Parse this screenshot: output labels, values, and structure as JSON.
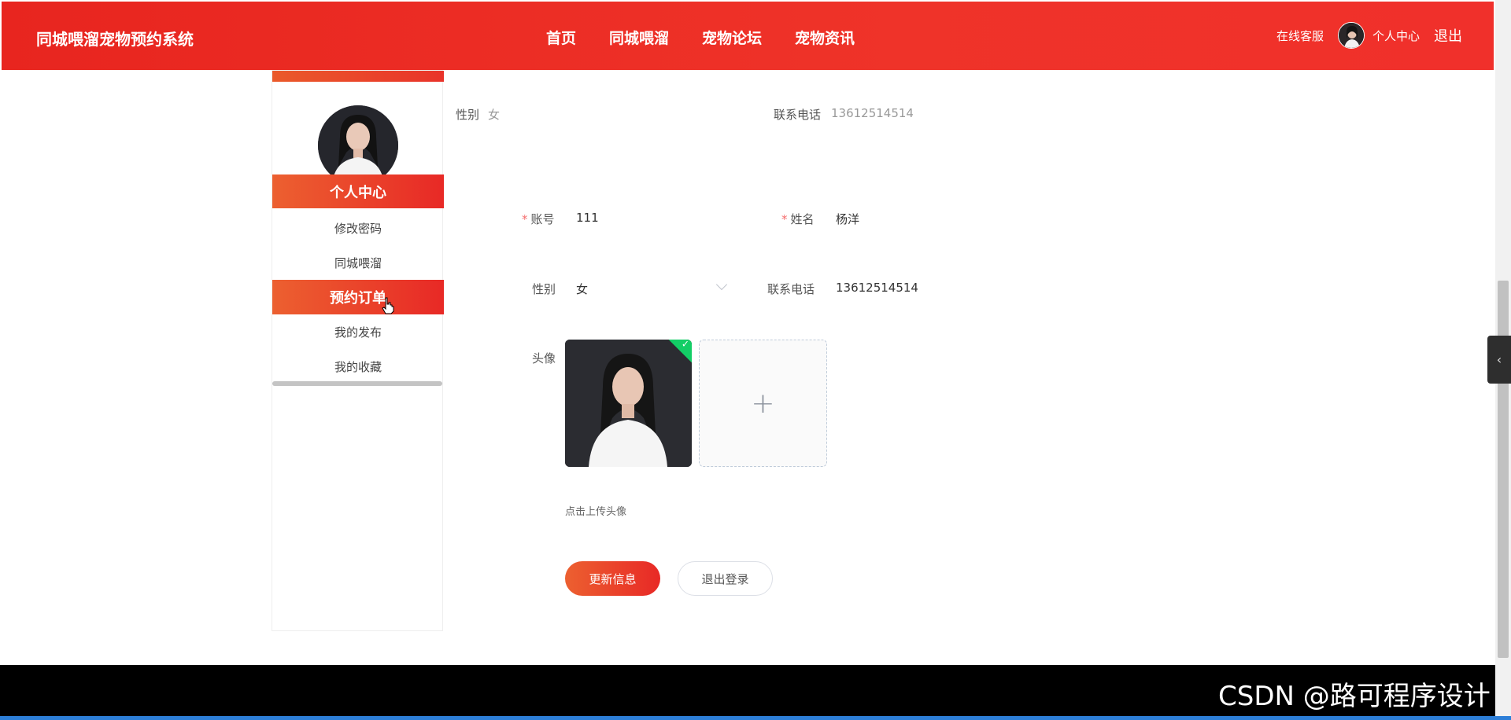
{
  "header": {
    "brand": "同城喂溜宠物预约系统",
    "nav": [
      "首页",
      "同城喂溜",
      "宠物论坛",
      "宠物资讯"
    ],
    "service": "在线客服",
    "personal_center": "个人中心",
    "logout": "退出"
  },
  "sidebar": {
    "title": "个人中心",
    "items": [
      {
        "label": "修改密码",
        "active": false
      },
      {
        "label": "同城喂溜",
        "active": false
      },
      {
        "label": "预约订单",
        "active": true
      },
      {
        "label": "我的发布",
        "active": false
      },
      {
        "label": "我的收藏",
        "active": false
      }
    ]
  },
  "summary": {
    "gender_label": "性别",
    "gender_value": "女",
    "phone_label": "联系电话",
    "phone_value": "13612514514"
  },
  "form": {
    "account_label": "账号",
    "account_value": "111",
    "name_label": "姓名",
    "name_value": "杨洋",
    "gender_label": "性别",
    "gender_value": "女",
    "phone_label": "联系电话",
    "phone_value": "13612514514",
    "avatar_label": "头像",
    "upload_hint": "点击上传头像",
    "required_mark": "*"
  },
  "buttons": {
    "update": "更新信息",
    "logout": "退出登录"
  },
  "watermark": "CSDN @路可程序设计",
  "icons": {
    "add": "+",
    "check": "✓",
    "toggle": "‹"
  },
  "colors": {
    "primary": "#e8251f",
    "accent_orange": "#ec6030",
    "success": "#13ce66"
  }
}
